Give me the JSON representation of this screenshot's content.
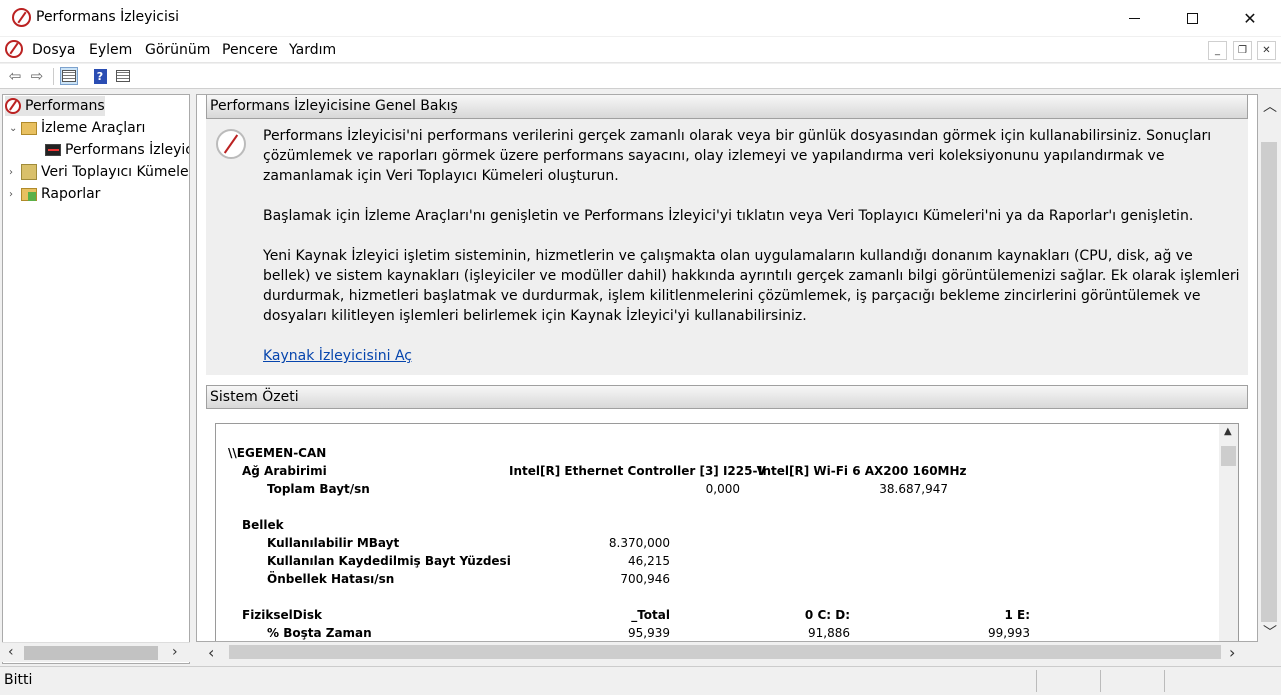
{
  "window": {
    "title": "Performans İzleyicisi"
  },
  "menu": [
    "Dosya",
    "Eylem",
    "Görünüm",
    "Pencere",
    "Yardım"
  ],
  "tree": [
    {
      "label": "Performans"
    },
    {
      "label": "İzleme Araçları"
    },
    {
      "label": "Performans İzleyici"
    },
    {
      "label": "Veri Toplayıcı Kümele"
    },
    {
      "label": "Raporlar"
    }
  ],
  "overview": {
    "header": "Performans İzleyicisine Genel Bakış",
    "p1": "Performans İzleyicisi'ni performans verilerini gerçek zamanlı olarak veya bir günlük dosyasından görmek için kullanabilirsiniz. Sonuçları çözümlemek ve raporları görmek üzere performans sayacını, olay izlemeyi ve yapılandırma veri koleksiyonunu yapılandırmak ve zamanlamak için Veri Toplayıcı Kümeleri oluşturun.",
    "p2": "Başlamak için İzleme Araçları'nı genişletin ve Performans İzleyici'yi tıklatın veya Veri Toplayıcı Kümeleri'ni ya da Raporlar'ı genişletin.",
    "p3": "Yeni Kaynak İzleyici işletim sisteminin, hizmetlerin ve çalışmakta olan uygulamaların kullandığı donanım kaynakları (CPU, disk, ağ ve bellek) ve sistem kaynakları (işleyiciler ve modüller dahil) hakkında ayrıntılı gerçek zamanlı bilgi görüntülemenizi sağlar. Ek olarak işlemleri durdurmak, hizmetleri başlatmak ve durdurmak, işlem kilitlenmelerini çözümlemek, iş parçacığı bekleme zincirlerini görüntülemek ve dosyaları kilitleyen işlemleri belirlemek için Kaynak İzleyici'yi kullanabilirsiniz.",
    "link": "Kaynak İzleyicisini Aç"
  },
  "summary": {
    "header": "Sistem Özeti",
    "machine": "\\\\EGEMEN-CAN",
    "network": {
      "label": "Ağ Arabirimi",
      "col1": "Intel[R] Ethernet Controller [3] I225-V",
      "col2": "Intel[R] Wi-Fi 6 AX200 160MHz",
      "counter": "Toplam Bayt/sn",
      "v1": "0,000",
      "v2": "38.687,947"
    },
    "memory": {
      "label": "Bellek",
      "rows": [
        {
          "name": "Kullanılabilir MBayt",
          "value": "8.370,000"
        },
        {
          "name": "Kullanılan Kaydedilmiş Bayt Yüzdesi",
          "value": "46,215"
        },
        {
          "name": "Önbellek Hatası/sn",
          "value": "700,946"
        }
      ]
    },
    "disk": {
      "label": "FizikselDisk",
      "col1": "_Total",
      "col2": "0 C: D:",
      "col3": "1 E:",
      "counter": "% Boşta Zaman",
      "v1": "95,939",
      "v2": "91,886",
      "v3": "99,993"
    }
  },
  "status": {
    "text": "Bitti"
  }
}
